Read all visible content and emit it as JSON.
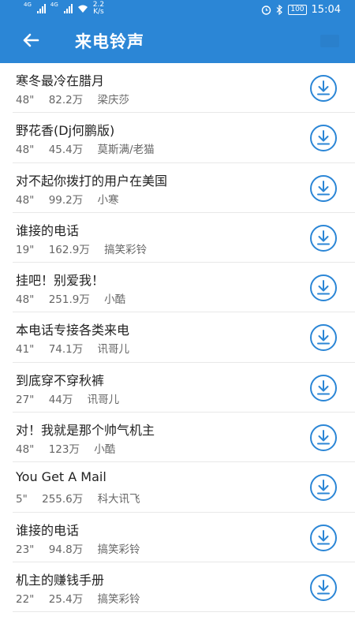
{
  "status": {
    "net_tag1": "4G",
    "net_tag2": "4G",
    "speed_value": "2.2",
    "speed_unit": "K/s",
    "battery": "100",
    "time": "15:04"
  },
  "header": {
    "title": "来电铃声"
  },
  "ringtones": [
    {
      "name": "寒冬最冷在腊月",
      "duration": "48\"",
      "plays": "82.2万",
      "artist": "梁庆莎"
    },
    {
      "name": "野花香(Dj何鹏版)",
      "duration": "48\"",
      "plays": "45.4万",
      "artist": "莫斯满/老猫"
    },
    {
      "name": "对不起你拨打的用户在美国",
      "duration": "48\"",
      "plays": "99.2万",
      "artist": "小寒"
    },
    {
      "name": "谁接的电话",
      "duration": "19\"",
      "plays": "162.9万",
      "artist": "搞笑彩铃"
    },
    {
      "name": "挂吧！别爱我！",
      "duration": "48\"",
      "plays": "251.9万",
      "artist": "小酷"
    },
    {
      "name": "本电话专接各类来电",
      "duration": "41\"",
      "plays": "74.1万",
      "artist": "讯哥儿"
    },
    {
      "name": "到底穿不穿秋裤",
      "duration": "27\"",
      "plays": "44万",
      "artist": "讯哥儿"
    },
    {
      "name": "对！我就是那个帅气机主",
      "duration": "48\"",
      "plays": "123万",
      "artist": "小酷"
    },
    {
      "name": "You Get A Mail",
      "duration": "5\"",
      "plays": "255.6万",
      "artist": "科大讯飞"
    },
    {
      "name": "谁接的电话",
      "duration": "23\"",
      "plays": "94.8万",
      "artist": "搞笑彩铃"
    },
    {
      "name": "机主的赚钱手册",
      "duration": "22\"",
      "plays": "25.4万",
      "artist": "搞笑彩铃"
    }
  ],
  "colors": {
    "accent": "#2b86d6",
    "icon": "#2b86d6"
  }
}
